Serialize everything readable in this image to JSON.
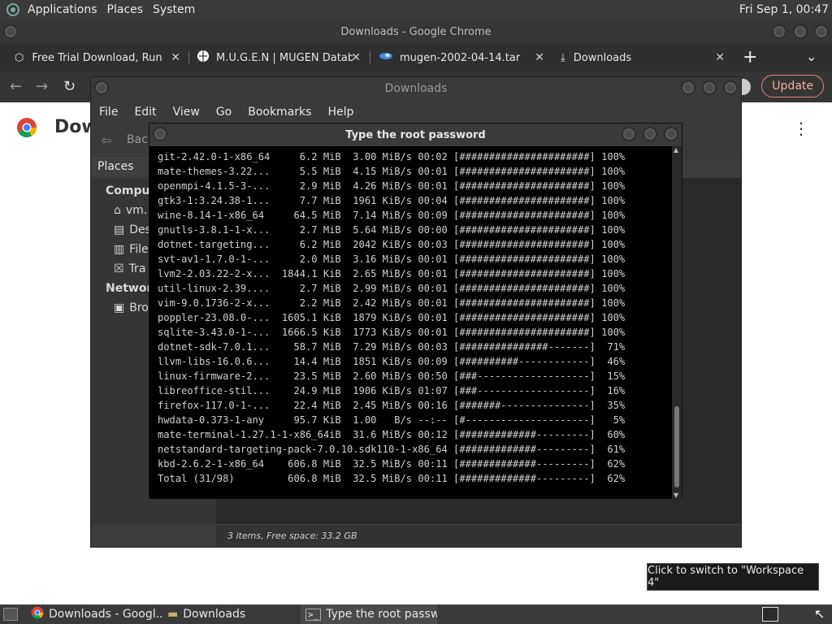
{
  "topbar": {
    "menus": [
      "Applications",
      "Places",
      "System"
    ],
    "clock": "Fri Sep  1, 00:47"
  },
  "chrome": {
    "window_title": "Downloads - Google Chrome",
    "tabs": [
      {
        "label": "Free Trial Download, Run W",
        "icon": "cube-icon"
      },
      {
        "label": "M.U.G.E.N | MUGEN Databa",
        "icon": "globe-icon"
      },
      {
        "label": "mugen-2002-04-14.tar",
        "icon": "file-icon"
      },
      {
        "label": "Downloads",
        "icon": "download-icon"
      }
    ],
    "update_label": "Update",
    "page_title_partial": "Dow"
  },
  "file_manager": {
    "title": "Downloads",
    "menus": [
      "File",
      "Edit",
      "View",
      "Go",
      "Bookmarks",
      "Help"
    ],
    "back_label": "Back",
    "places_label": "Places",
    "sidebar": {
      "computer_header": "Compute",
      "computer_items": [
        "vm.",
        "Des",
        "File",
        "Tra"
      ],
      "network_header": "Network",
      "network_items": [
        "Bro"
      ]
    },
    "status": "3 items, Free space: 33.2 GB"
  },
  "terminal": {
    "title": "Type the root password",
    "lines": [
      "git-2.42.0-1-x86_64     6.2 MiB  3.00 MiB/s 00:02 [######################] 100%",
      "mate-themes-3.22...     5.5 MiB  4.15 MiB/s 00:01 [######################] 100%",
      "openmpi-4.1.5-3-...     2.9 MiB  4.26 MiB/s 00:01 [######################] 100%",
      "gtk3-1:3.24.38-1...     7.7 MiB  1961 KiB/s 00:04 [######################] 100%",
      "wine-8.14-1-x86_64     64.5 MiB  7.14 MiB/s 00:09 [######################] 100%",
      "gnutls-3.8.1-1-x...     2.7 MiB  5.64 MiB/s 00:00 [######################] 100%",
      "dotnet-targeting...     6.2 MiB  2042 KiB/s 00:03 [######################] 100%",
      "svt-av1-1.7.0-1-...     2.0 MiB  3.16 MiB/s 00:01 [######################] 100%",
      "lvm2-2.03.22-2-x...  1844.1 KiB  2.65 MiB/s 00:01 [######################] 100%",
      "util-linux-2.39....     2.7 MiB  2.99 MiB/s 00:01 [######################] 100%",
      "vim-9.0.1736-2-x...     2.2 MiB  2.42 MiB/s 00:01 [######################] 100%",
      "poppler-23.08.0-...  1605.1 KiB  1879 KiB/s 00:01 [######################] 100%",
      "sqlite-3.43.0-1-...  1666.5 KiB  1773 KiB/s 00:01 [######################] 100%",
      "dotnet-sdk-7.0.1...    58.7 MiB  7.29 MiB/s 00:03 [###############-------]  71%",
      "llvm-libs-16.0.6...    14.4 MiB  1851 KiB/s 00:09 [##########------------]  46%",
      "linux-firmware-2...    23.5 MiB  2.60 MiB/s 00:50 [###-------------------]  15%",
      "libreoffice-stil...    24.9 MiB  1906 KiB/s 01:07 [###-------------------]  16%",
      "firefox-117.0-1-...    22.4 MiB  2.45 MiB/s 00:16 [#######---------------]  35%",
      "hwdata-0.373-1-any     95.7 KiB  1.00   B/s --:-- [#---------------------]   5%",
      "mate-terminal-1.27.1-1-x86_64iB  31.6 MiB/s 00:12 [#############---------]  60%",
      "netstandard-targeting-pack-7.0.10.sdk110-1-x86_64 [#############---------]  61%",
      "kbd-2.6.2-1-x86_64    606.8 MiB  32.5 MiB/s 00:11 [#############---------]  62%",
      "Total (31/98)         606.8 MiB  32.5 MiB/s 00:11 [#############---------]  62%"
    ]
  },
  "tooltip": "Click to switch to \"Workspace 4\"",
  "taskbar": {
    "tasks": [
      {
        "label": "Downloads - Googl...",
        "icon": "chrome-icon"
      },
      {
        "label": "Downloads",
        "icon": "folder-icon"
      },
      {
        "label": "Type the root passw...",
        "icon": "terminal-icon"
      }
    ]
  }
}
